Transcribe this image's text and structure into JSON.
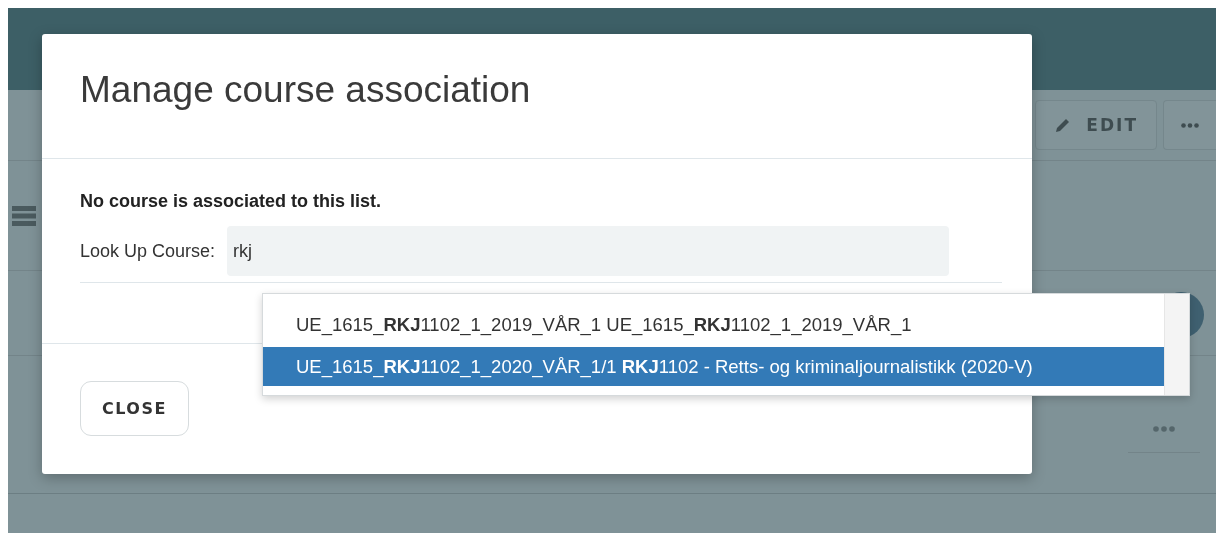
{
  "background": {
    "edit_button": {
      "label": "EDIT"
    }
  },
  "dialog": {
    "title": "Manage course association",
    "message": "No course is associated to this list.",
    "lookup": {
      "label": "Look Up Course:",
      "value": "rkj"
    },
    "suggestions": [
      {
        "text": "UE_1615_**RKJ**1102_1_2019_VÅR_1 UE_1615_**RKJ**1102_1_2019_VÅR_1",
        "selected": false
      },
      {
        "text": "UE_1615_**RKJ**1102_1_2020_VÅR_1/1 **RKJ**1102 - Retts- og kriminaljournalistikk (2020-V)",
        "selected": true
      }
    ],
    "buttons": [
      {
        "label": "CLOSE"
      }
    ]
  }
}
